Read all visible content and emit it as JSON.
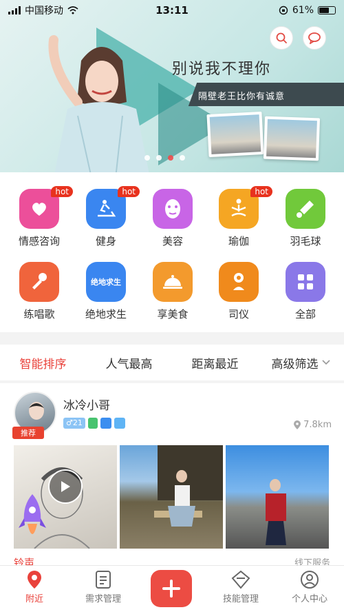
{
  "status_bar": {
    "carrier": "中国移动",
    "time": "13:11",
    "battery": "61%"
  },
  "banner": {
    "headline": "别说我不理你",
    "subline": "隔壁老王比你有诚意",
    "slide_count": 4,
    "active_slide_index": 2
  },
  "categories": [
    {
      "label": "情感咨询",
      "icon": "heart-chat-icon",
      "hot": "hot",
      "color": "#ec4f9a"
    },
    {
      "label": "健身",
      "icon": "treadmill-icon",
      "hot": "hot",
      "color": "#3a86f0"
    },
    {
      "label": "美容",
      "icon": "face-mask-icon",
      "hot": "",
      "color": "#c865e6"
    },
    {
      "label": "瑜伽",
      "icon": "yoga-icon",
      "hot": "hot",
      "color": "#f5a623"
    },
    {
      "label": "羽毛球",
      "icon": "shuttlecock-icon",
      "hot": "",
      "color": "#71c93b"
    },
    {
      "label": "练唱歌",
      "icon": "microphone-icon",
      "hot": "",
      "color": "#f0643c"
    },
    {
      "label": "绝地求生",
      "icon": "game-badge-icon",
      "badge_text": "绝地求生",
      "hot": "",
      "color": "#3a86f0"
    },
    {
      "label": "享美食",
      "icon": "food-dome-icon",
      "hot": "",
      "color": "#f39a2d"
    },
    {
      "label": "司仪",
      "icon": "host-icon",
      "hot": "",
      "color": "#f08a1c"
    },
    {
      "label": "全部",
      "icon": "grid-all-icon",
      "hot": "",
      "color": "#8a78e8"
    }
  ],
  "sort_tabs": [
    {
      "label": "智能排序",
      "active": true
    },
    {
      "label": "人气最高",
      "active": false
    },
    {
      "label": "距离最近",
      "active": false
    },
    {
      "label": "高级筛选",
      "active": false
    }
  ],
  "post": {
    "username": "冰冷小哥",
    "recommend_badge": "推荐",
    "gender_age": "♂21",
    "distance": "7.8km"
  },
  "footer_partial": {
    "left": "铃声",
    "right": "线下服务"
  },
  "nav": [
    {
      "label": "附近",
      "icon": "location-pin-icon",
      "active": true
    },
    {
      "label": "需求管理",
      "icon": "clipboard-icon",
      "active": false
    },
    {
      "label": "",
      "icon": "plus-icon",
      "active": false
    },
    {
      "label": "技能管理",
      "icon": "skill-diamond-icon",
      "active": false
    },
    {
      "label": "个人中心",
      "icon": "user-icon",
      "active": false
    }
  ],
  "colors": {
    "accent": "#e9423b",
    "hot_badge": "#e8321e"
  }
}
